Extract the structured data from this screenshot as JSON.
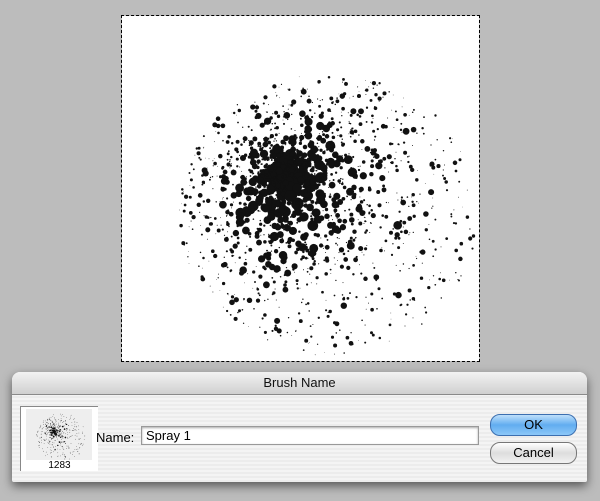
{
  "dialog": {
    "title": "Brush Name",
    "name_label": "Name:",
    "name_value": "Spray 1",
    "brush_size": "1283",
    "ok_label": "OK",
    "cancel_label": "Cancel"
  },
  "colors": {
    "accent": "#62adf0",
    "background": "#bcbcbc"
  }
}
